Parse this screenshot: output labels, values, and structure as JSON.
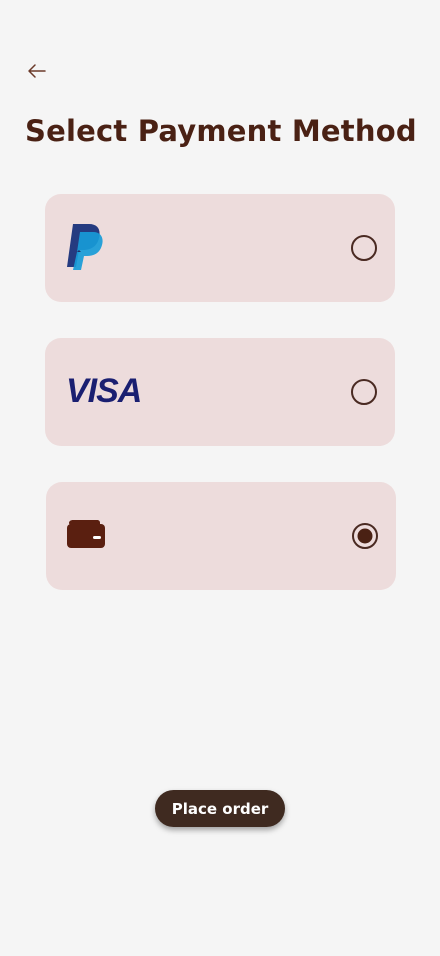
{
  "header": {
    "back_icon": "arrow-left-icon",
    "title": "Select Payment Method"
  },
  "payment_methods": [
    {
      "id": "paypal",
      "icon": "paypal-logo",
      "selected": false
    },
    {
      "id": "visa",
      "icon": "visa-logo",
      "logo_text": "VISA",
      "selected": false
    },
    {
      "id": "wallet",
      "icon": "wallet-icon",
      "selected": true
    }
  ],
  "footer": {
    "place_order_label": "Place order"
  },
  "colors": {
    "background": "#f5f5f5",
    "card": "#eddcdc",
    "title": "#4a2114",
    "button": "#3f2a20",
    "visa_blue": "#1a1f71",
    "paypal_dark": "#253b80",
    "paypal_light": "#179bd7",
    "wallet": "#5a1f10"
  }
}
